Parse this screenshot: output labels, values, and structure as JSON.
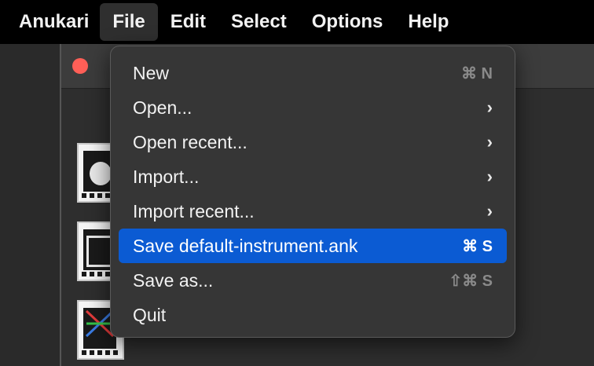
{
  "menubar": {
    "app_name": "Anukari",
    "items": [
      "File",
      "Edit",
      "Select",
      "Options",
      "Help"
    ]
  },
  "file_menu": {
    "items": [
      {
        "label": "New",
        "shortcut": "⌘ N",
        "submenu": false,
        "enabled_shortcut": false
      },
      {
        "label": "Open...",
        "shortcut": "",
        "submenu": true
      },
      {
        "label": "Open recent...",
        "shortcut": "",
        "submenu": true
      },
      {
        "label": "Import...",
        "shortcut": "",
        "submenu": true
      },
      {
        "label": "Import recent...",
        "shortcut": "",
        "submenu": true
      },
      {
        "label": "Save default-instrument.ank",
        "shortcut": "⌘ S",
        "submenu": false,
        "highlighted": true
      },
      {
        "label": "Save as...",
        "shortcut": "⇧⌘ S",
        "submenu": false
      },
      {
        "label": "Quit",
        "shortcut": "",
        "submenu": false
      }
    ],
    "chevron": "›"
  },
  "colors": {
    "highlight": "#0b5bd3",
    "close_button": "#ff5f57"
  },
  "icons": {
    "close": "close-dot-icon",
    "submenu": "chevron-right-icon"
  }
}
